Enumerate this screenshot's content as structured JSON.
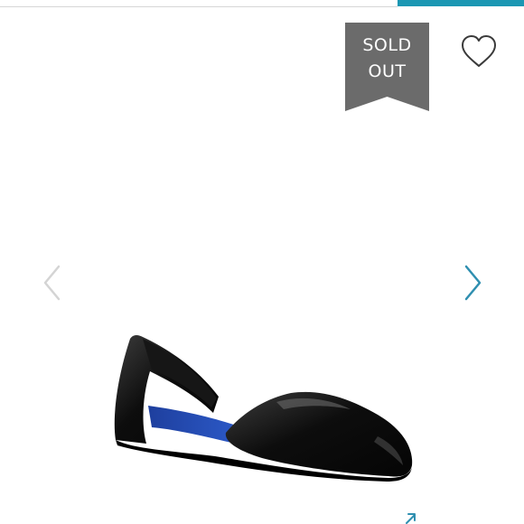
{
  "badge": {
    "line1": "SOLD",
    "line2": "OUT",
    "color": "#6b6b6b"
  },
  "favorite": {
    "icon": "heart-outline-icon"
  },
  "carousel": {
    "prev_icon": "chevron-left-icon",
    "next_icon": "chevron-right-icon",
    "prev_color": "#d4d4d4",
    "next_color": "#2f8fb0"
  },
  "product": {
    "image": "black-patent-dorsay-flat-photo"
  },
  "expand": {
    "icon": "arrow-up-right-icon"
  },
  "colors": {
    "accent": "#1b97b3",
    "divider": "#d6d6d6"
  }
}
